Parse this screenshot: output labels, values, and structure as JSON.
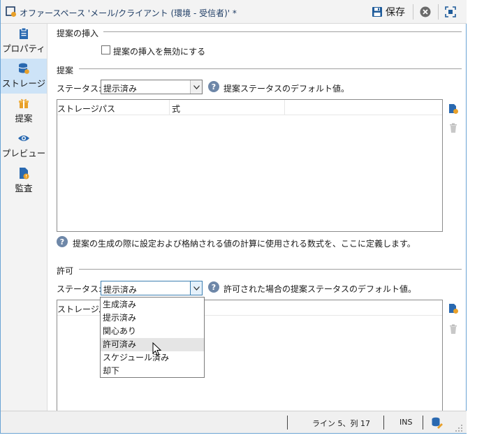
{
  "window": {
    "title": "オファースペース 'メール/クライアント (環境 - 受信者)' *",
    "save_label": "保存",
    "accent": "#1e3c64"
  },
  "sidebar": {
    "items": [
      {
        "label": "プロパティ",
        "icon": "clipboard-icon"
      },
      {
        "label": "ストレージ",
        "icon": "database-icon",
        "active": true
      },
      {
        "label": "提案",
        "icon": "gift-icon"
      },
      {
        "label": "プレビュー",
        "icon": "eye-icon"
      },
      {
        "label": "監査",
        "icon": "audit-icon"
      }
    ]
  },
  "section_insert": {
    "title": "提案の挿入",
    "checkbox_label": "提案の挿入を無効にする",
    "checked": false
  },
  "section_proposal": {
    "title": "提案",
    "status_label": "ステータス:",
    "status_value": "提示済み",
    "status_help": "提案ステータスのデフォルト値。",
    "grid_columns": [
      "ストレージパス",
      "式"
    ],
    "help_text": "提案の生成の際に設定および格納される値の計算に使用される数式を、ここに定義します。"
  },
  "section_permit": {
    "title": "許可",
    "status_label": "ステータス:",
    "status_value": "提示済み",
    "status_help": "許可された場合の提案ステータスのデフォルト値。",
    "grid_columns": [
      "ストレージパス"
    ],
    "dropdown_options": [
      "生成済み",
      "提示済み",
      "関心あり",
      "許可済み",
      "スケジュール済み",
      "却下"
    ],
    "hovered_option": "許可済み"
  },
  "statusbar": {
    "position": "ライン 5、列 17",
    "mode": "INS"
  }
}
